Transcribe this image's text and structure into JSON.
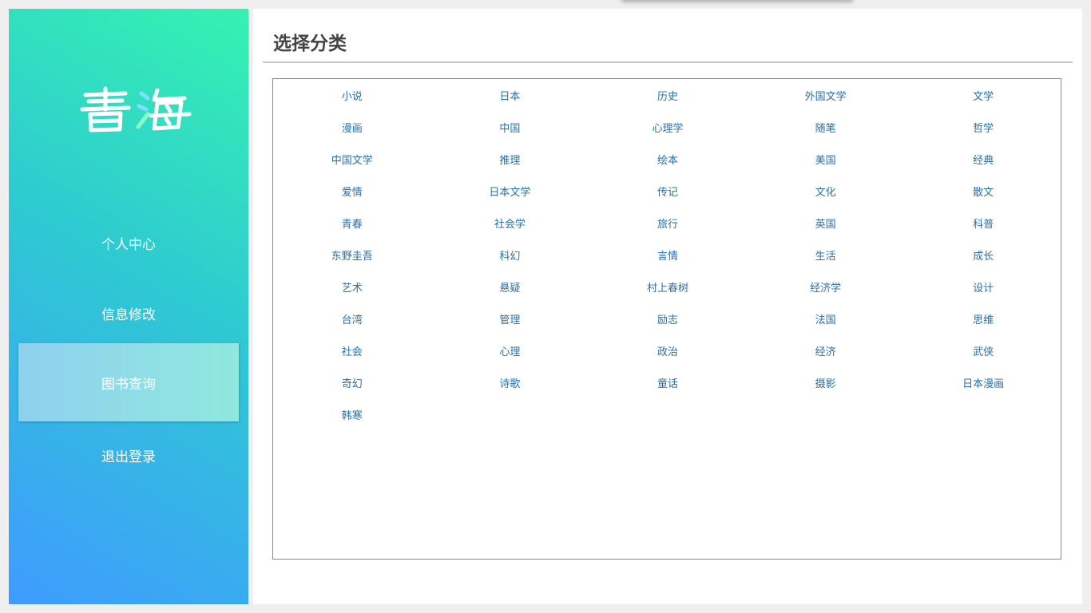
{
  "sidebar": {
    "logo_text": "書海",
    "nav": [
      {
        "label": "个人中心",
        "active": false
      },
      {
        "label": "信息修改",
        "active": false
      },
      {
        "label": "图书查询",
        "active": true
      },
      {
        "label": "退出登录",
        "active": false
      }
    ]
  },
  "main": {
    "title": "选择分类",
    "categories": [
      "小说",
      "日本",
      "历史",
      "外国文学",
      "文学",
      "漫画",
      "中国",
      "心理学",
      "随笔",
      "哲学",
      "中国文学",
      "推理",
      "绘本",
      "美国",
      "经典",
      "爱情",
      "日本文学",
      "传记",
      "文化",
      "散文",
      "青春",
      "社会学",
      "旅行",
      "英国",
      "科普",
      "东野圭吾",
      "科幻",
      "言情",
      "生活",
      "成长",
      "艺术",
      "悬疑",
      "村上春树",
      "经济学",
      "设计",
      "台湾",
      "管理",
      "励志",
      "法国",
      "思维",
      "社会",
      "心理",
      "政治",
      "经济",
      "武侠",
      "奇幻",
      "诗歌",
      "童话",
      "摄影",
      "日本漫画",
      "韩寒"
    ]
  },
  "colors": {
    "sidebar_gradient_start": "#3f9bff",
    "sidebar_gradient_end": "#35f2b0",
    "category_link": "#2a6fa8",
    "title_text": "#444444"
  }
}
